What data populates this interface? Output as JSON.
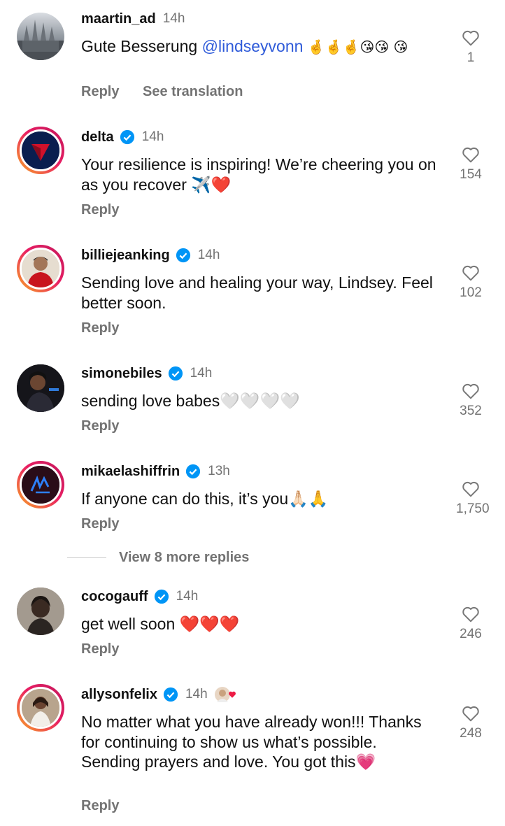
{
  "comments": [
    {
      "username": "maartin_ad",
      "verified": false,
      "time": "14h",
      "text_before": "Gute Besserung ",
      "mention": "@lindseyvonn",
      "text_after": " 🤞🤞🤞😘😘 😘",
      "likes": "1",
      "reply": "Reply",
      "translate": "See translation"
    },
    {
      "username": "delta",
      "verified": true,
      "time": "14h",
      "text": "Your resilience is inspiring! We’re cheering you on as you recover ✈️❤️",
      "likes": "154",
      "reply": "Reply"
    },
    {
      "username": "billiejeanking",
      "verified": true,
      "time": "14h",
      "text": "Sending love and healing your way, Lindsey. Feel better soon.",
      "likes": "102",
      "reply": "Reply"
    },
    {
      "username": "simonebiles",
      "verified": true,
      "time": "14h",
      "text": "sending love babes🤍🤍🤍🤍",
      "likes": "352",
      "reply": "Reply"
    },
    {
      "username": "mikaelashiffrin",
      "verified": true,
      "time": "13h",
      "text": "If anyone can do this, it’s you🙏🏻🙏",
      "likes": "1,750",
      "reply": "Reply"
    },
    {
      "username": "cocogauff",
      "verified": true,
      "time": "14h",
      "text": "get well soon ❤️❤️❤️",
      "likes": "246",
      "reply": "Reply"
    },
    {
      "username": "allysonfelix",
      "verified": true,
      "time": "14h",
      "text": "No matter what you have already won!!! Thanks for continuing to show us what’s possible. Sending prayers and love. You got this💗",
      "likes": "248",
      "reply": "Reply"
    }
  ],
  "view_more": "View 8 more replies",
  "colors": {
    "verified": "#0095f6",
    "muted": "#737373",
    "mention": "#2f5bd9",
    "story_ring": "#e91e63"
  }
}
